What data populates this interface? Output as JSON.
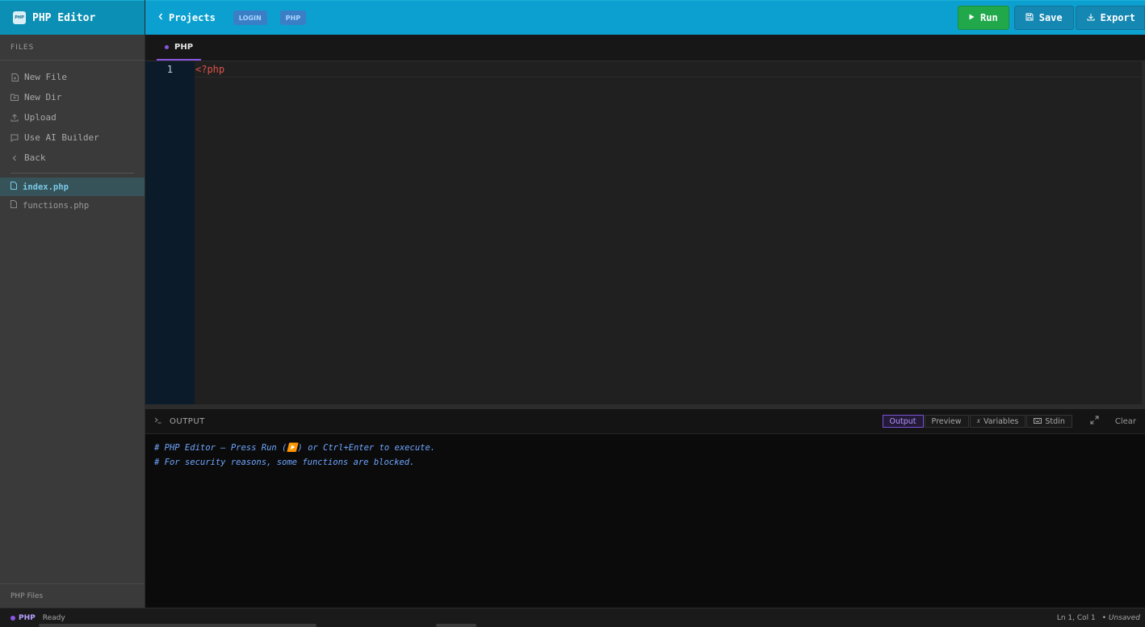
{
  "app": {
    "logo_text": "PHP",
    "title": "PHP Editor"
  },
  "sidebar": {
    "section_title": "FILES",
    "actions": [
      {
        "label": "New File",
        "icon": "new-file-icon"
      },
      {
        "label": "New Dir",
        "icon": "new-folder-icon"
      },
      {
        "label": "Upload",
        "icon": "upload-icon"
      },
      {
        "label": "Use AI Builder",
        "icon": "chat-icon"
      },
      {
        "label": "Back",
        "icon": "chevron-left-icon"
      }
    ],
    "files": [
      {
        "name": "index.php",
        "active": true
      },
      {
        "name": "functions.php",
        "active": false
      }
    ],
    "footer": "PHP Files"
  },
  "header": {
    "breadcrumb": "Projects",
    "tags": [
      "LOGIN",
      "PHP"
    ],
    "run_label": "Run",
    "save_label": "Save",
    "export_label": "Export"
  },
  "editor": {
    "tab_label": "PHP",
    "line_numbers": [
      "1"
    ],
    "code_lines": [
      "<?php"
    ]
  },
  "output": {
    "title": "OUTPUT",
    "tabs": [
      "Output",
      "Preview",
      "Variables",
      "Stdin"
    ],
    "active_tab": "Output",
    "clear_label": "Clear",
    "lines": [
      "# PHP Editor — Press Run (▶️) or Ctrl+Enter to execute.",
      "# For security reasons, some functions are blocked."
    ]
  },
  "status": {
    "language": "PHP",
    "state": "Ready",
    "position": "Ln 1, Col 1",
    "save_state": "• Unsaved"
  },
  "colors": {
    "header": "#0ba0d0",
    "run_button": "#20a84a",
    "accent": "#8a55e0"
  }
}
